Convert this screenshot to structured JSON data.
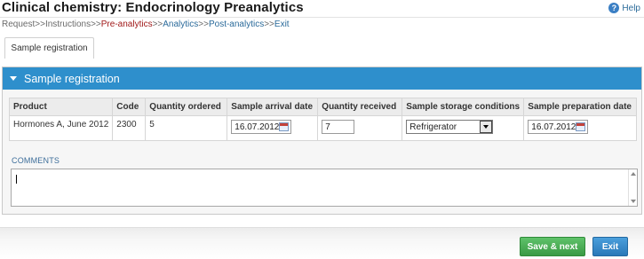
{
  "header": {
    "title": "Clinical chemistry: Endocrinology Preanalytics",
    "help_label": "Help"
  },
  "breadcrumb": {
    "items": [
      "Request",
      "Instructions",
      "Pre-analytics",
      "Analytics",
      "Post-analytics",
      "Exit"
    ],
    "separator": ">>",
    "current_index": 2
  },
  "tabs": [
    {
      "label": "Sample registration",
      "active": true
    }
  ],
  "panel": {
    "title": "Sample registration",
    "table": {
      "columns": [
        "Product",
        "Code",
        "Quantity ordered",
        "Sample arrival date",
        "Quantity received",
        "Sample storage conditions",
        "Sample preparation date"
      ],
      "rows": [
        {
          "product": "Hormones A, June 2012",
          "code": "2300",
          "quantity_ordered": "5",
          "arrival_date": "16.07.2012",
          "quantity_received": "7",
          "storage": "Refrigerator",
          "preparation_date": "16.07.2012"
        }
      ]
    },
    "comments_label": "COMMENTS",
    "comments_value": ""
  },
  "footer": {
    "save_label": "Save & next",
    "exit_label": "Exit"
  },
  "colors": {
    "panel_header": "#2e8fcc",
    "current_step": "#a01818",
    "link": "#2a6a9a",
    "save_button": "#3a9a45",
    "exit_button": "#2a78b8"
  }
}
